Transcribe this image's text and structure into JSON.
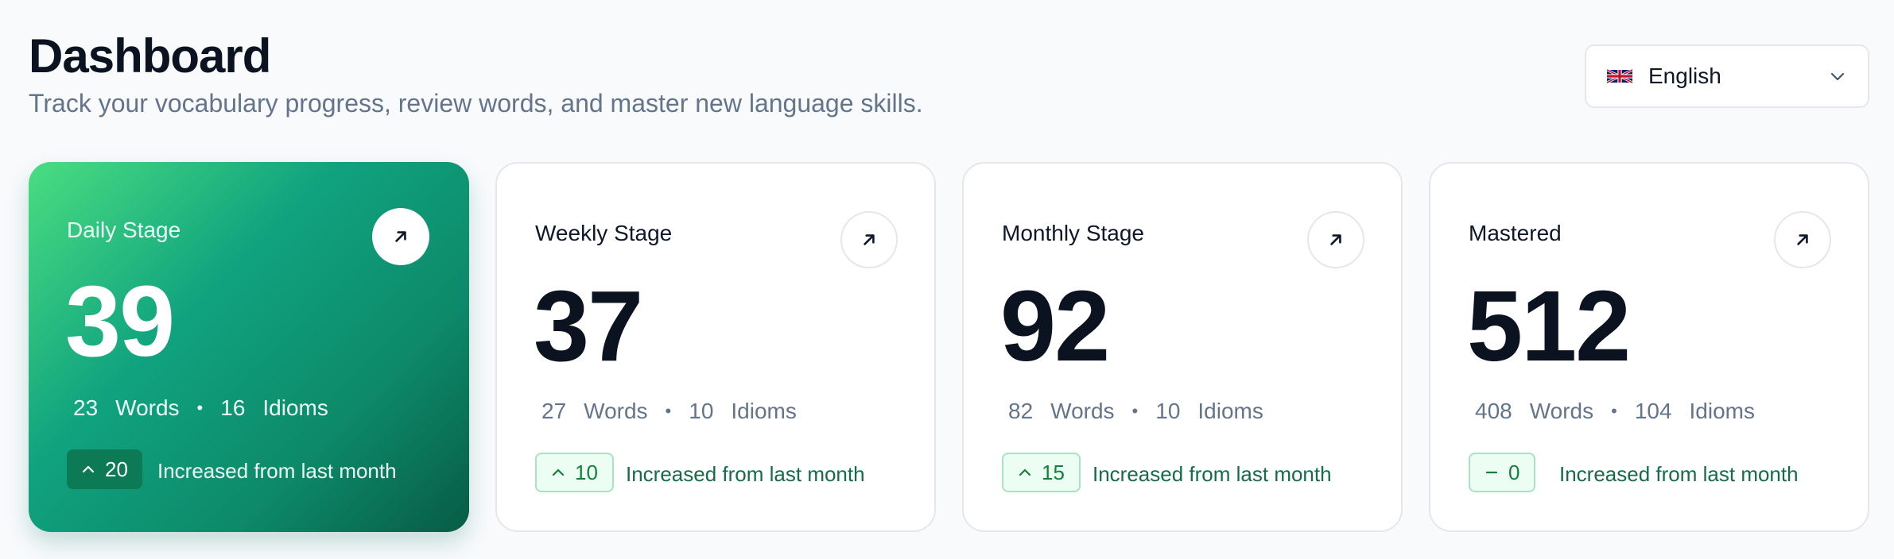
{
  "header": {
    "title": "Dashboard",
    "subtitle": "Track your vocabulary progress, review words, and master new language skills."
  },
  "language": {
    "selected": "English",
    "flag": "uk-flag-icon"
  },
  "cards": [
    {
      "label": "Daily Stage",
      "value": "39",
      "words": "23",
      "words_label": "Words",
      "idioms": "16",
      "idioms_label": "Idioms",
      "change": "20",
      "change_icon": "chevron-up-icon",
      "note": "Increased from last month"
    },
    {
      "label": "Weekly Stage",
      "value": "37",
      "words": "27",
      "words_label": "Words",
      "idioms": "10",
      "idioms_label": "Idioms",
      "change": "10",
      "change_icon": "chevron-up-icon",
      "note": "Increased from last month"
    },
    {
      "label": "Monthly Stage",
      "value": "92",
      "words": "82",
      "words_label": "Words",
      "idioms": "10",
      "idioms_label": "Idioms",
      "change": "15",
      "change_icon": "chevron-up-icon",
      "note": "Increased from last month"
    },
    {
      "label": "Mastered",
      "value": "512",
      "words": "408",
      "words_label": "Words",
      "idioms": "104",
      "idioms_label": "Idioms",
      "change": "0",
      "change_icon": "minus-icon",
      "note": "Increased from last month"
    }
  ],
  "colors": {
    "accent_gradient_start": "#4ade80",
    "accent_gradient_end": "#075c45",
    "badge_text": "#15803d"
  }
}
